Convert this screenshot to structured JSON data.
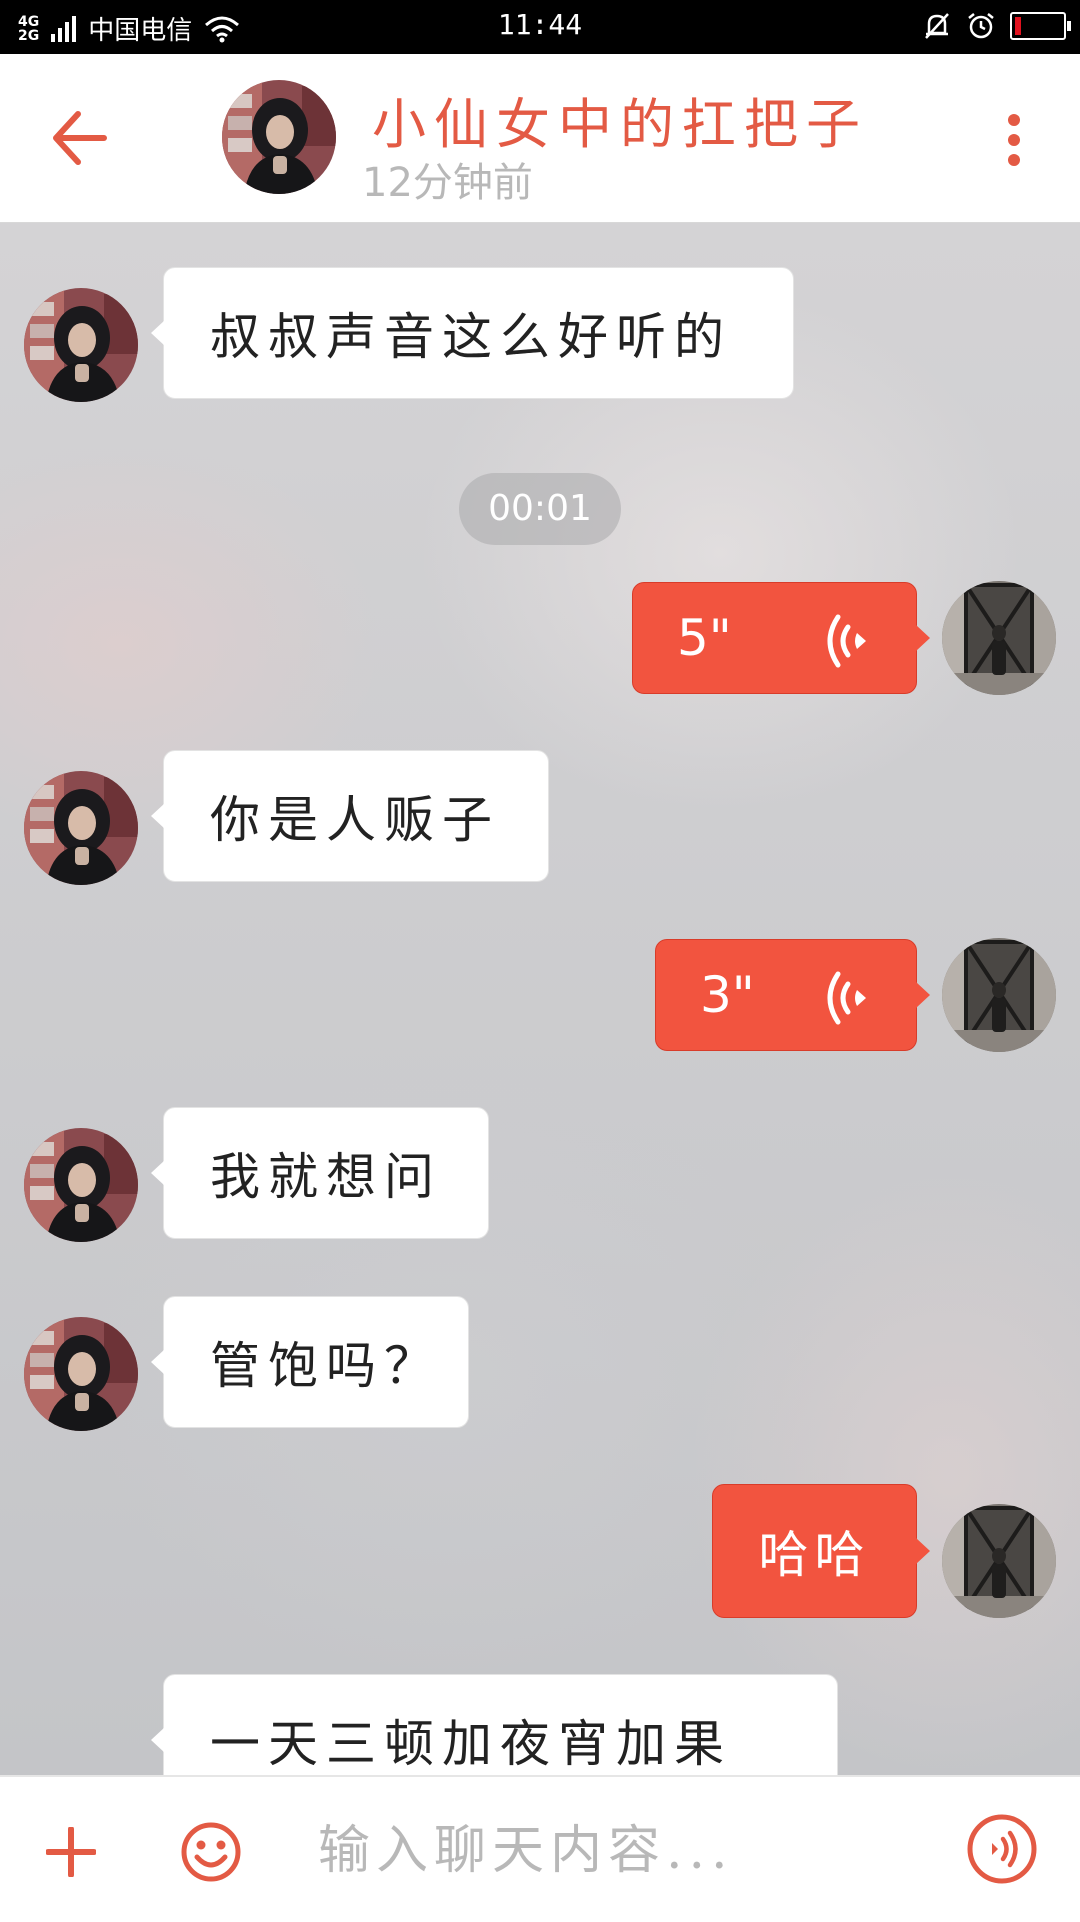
{
  "status_bar": {
    "network_top": "4G",
    "network_bottom": "2G",
    "carrier": "中国电信",
    "time": "11:44"
  },
  "header": {
    "title": "小仙女中的扛把子",
    "subtitle": "12分钟前"
  },
  "messages": [
    {
      "side": "left",
      "type": "text",
      "text": "叔叔声音这么好听的"
    },
    {
      "type": "timestamp",
      "text": "00:01"
    },
    {
      "side": "right",
      "type": "voice",
      "duration": "5\""
    },
    {
      "side": "left",
      "type": "text",
      "text": "你是人贩子"
    },
    {
      "side": "right",
      "type": "voice",
      "duration": "3\""
    },
    {
      "side": "left",
      "type": "text",
      "text": "我就想问"
    },
    {
      "side": "left",
      "type": "text",
      "text": "管饱吗？"
    },
    {
      "side": "right",
      "type": "text",
      "text": "哈哈"
    },
    {
      "side": "left",
      "type": "text",
      "text": "一天三顿加夜宵加果"
    }
  ],
  "composer": {
    "placeholder": "输入聊天内容..."
  },
  "colors": {
    "accent": "#f2543f",
    "title": "#e35a44",
    "muted": "#b8b8b8",
    "battery_low": "#e0121f"
  },
  "icons": [
    "back-arrow-icon",
    "more-vertical-icon",
    "voice-wave-icon",
    "plus-icon",
    "emoji-icon",
    "voice-input-icon",
    "wifi-icon",
    "mute-bell-icon",
    "alarm-icon",
    "battery-icon"
  ],
  "battery_level": 0.12
}
